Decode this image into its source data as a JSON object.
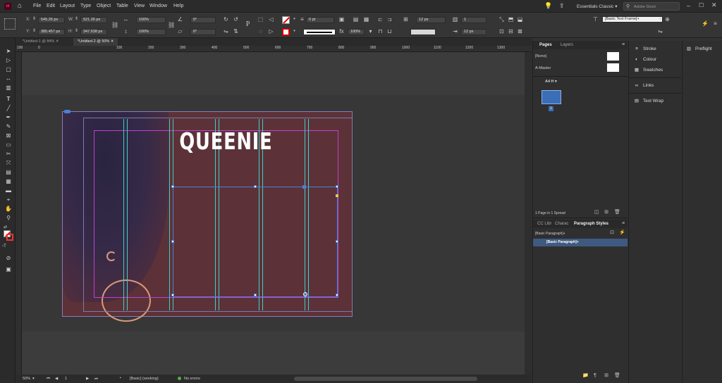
{
  "app": {
    "logo": "Id",
    "workspace": "Essentials Classic",
    "search_placeholder": "Adobe Stock"
  },
  "menu": [
    "File",
    "Edit",
    "Layout",
    "Type",
    "Object",
    "Table",
    "View",
    "Window",
    "Help"
  ],
  "control": {
    "x_label": "X:",
    "x": "545.26 px",
    "y_label": "Y:",
    "y": "385.457 px",
    "w_label": "W:",
    "w": "521.26 px",
    "h_label": "H:",
    "h": "347.638 px",
    "scale_x": "100%",
    "scale_y": "100%",
    "rotate": "0°",
    "shear": "0°",
    "stroke_weight": "0 pt",
    "opacity": "100%",
    "gap": "12 px",
    "count": "1",
    "offset": "12 px",
    "object_style": "[Basic Text Frame]+"
  },
  "tabs": [
    {
      "label": "*Untitled-1 @ 84%",
      "active": false
    },
    {
      "label": "*Untitled-2 @ 50%",
      "active": true
    }
  ],
  "ruler_ticks": [
    "100",
    "0",
    "100",
    "200",
    "300",
    "400",
    "500",
    "600",
    "700",
    "800",
    "900",
    "1000",
    "1100",
    "1200",
    "1300"
  ],
  "canvas": {
    "headline": "QUEENIE",
    "page_color": "#5c3238",
    "guide_color": "#3ad0c8",
    "margin_color": "#c040d0",
    "frame_color": "#4a7fd8"
  },
  "status": {
    "zoom": "50%",
    "page": "1",
    "mode": "[Basic] (working)",
    "errors": "No errors"
  },
  "pages_panel": {
    "tab_pages": "Pages",
    "tab_layers": "Layers",
    "none_label": "[None]",
    "master_label": "A-Master",
    "page_size": "A4 H",
    "page_number": "1",
    "footer": "1 Page in 1 Spread"
  },
  "styles_panel": {
    "tab_cc": "CC Libr",
    "tab_char": "Charac",
    "tab_para": "Paragraph Styles",
    "current_style": "[Basic Paragraph]+",
    "selected_item": "[Basic Paragraph]+"
  },
  "stack": [
    "Stroke",
    "Colour",
    "Swatches",
    "Links",
    "Text Wrap"
  ],
  "right_panel": {
    "preflight": "Preflight"
  }
}
